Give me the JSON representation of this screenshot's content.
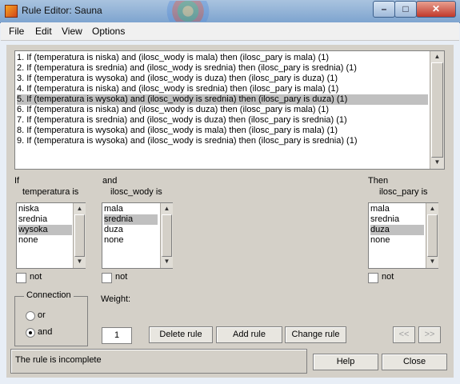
{
  "window": {
    "title": "Rule Editor: Sauna"
  },
  "menu": [
    "File",
    "Edit",
    "View",
    "Options"
  ],
  "rules": [
    "1. If (temperatura is niska) and (ilosc_wody is mala) then (ilosc_pary is mala) (1)",
    "2. If (temperatura is srednia) and (ilosc_wody is srednia) then (ilosc_pary is srednia) (1)",
    "3. If (temperatura is wysoka) and (ilosc_wody is duza) then (ilosc_pary is duza) (1)",
    "4. If (temperatura is niska) and (ilosc_wody is srednia) then (ilosc_pary is mala) (1)",
    "5. If (temperatura is wysoka) and (ilosc_wody is srednia) then (ilosc_pary is duza) (1)",
    "6. If (temperatura is niska) and (ilosc_wody is duza) then (ilosc_pary is mala) (1)",
    "7. If (temperatura is srednia) and (ilosc_wody is duza) then (ilosc_pary is srednia) (1)",
    "8. If (temperatura is wysoka) and (ilosc_wody is mala) then (ilosc_pary is mala) (1)",
    "9. If (temperatura is wysoka) and (ilosc_wody is srednia) then (ilosc_pary is srednia) (1)"
  ],
  "selected_rule_index": 4,
  "antecedents": {
    "if_label": "If",
    "and_label": "and",
    "temperatura": {
      "label": "temperatura is",
      "options": [
        "niska",
        "srednia",
        "wysoka",
        "none"
      ],
      "selected": "wysoka",
      "not_label": "not"
    },
    "ilosc_wody": {
      "label": "ilosc_wody is",
      "options": [
        "mala",
        "srednia",
        "duza",
        "none"
      ],
      "selected": "srednia",
      "not_label": "not"
    }
  },
  "consequent": {
    "then_label": "Then",
    "ilosc_pary": {
      "label": "ilosc_pary is",
      "options": [
        "mala",
        "srednia",
        "duza",
        "none"
      ],
      "selected": "duza",
      "not_label": "not"
    }
  },
  "connection": {
    "title": "Connection",
    "or_label": "or",
    "and_label": "and",
    "selected": "and"
  },
  "weight": {
    "label": "Weight:",
    "value": "1"
  },
  "buttons": {
    "delete": "Delete rule",
    "add": "Add rule",
    "change": "Change rule",
    "prev": "<<",
    "next": ">>",
    "help": "Help",
    "close": "Close"
  },
  "status": "The rule is incomplete"
}
